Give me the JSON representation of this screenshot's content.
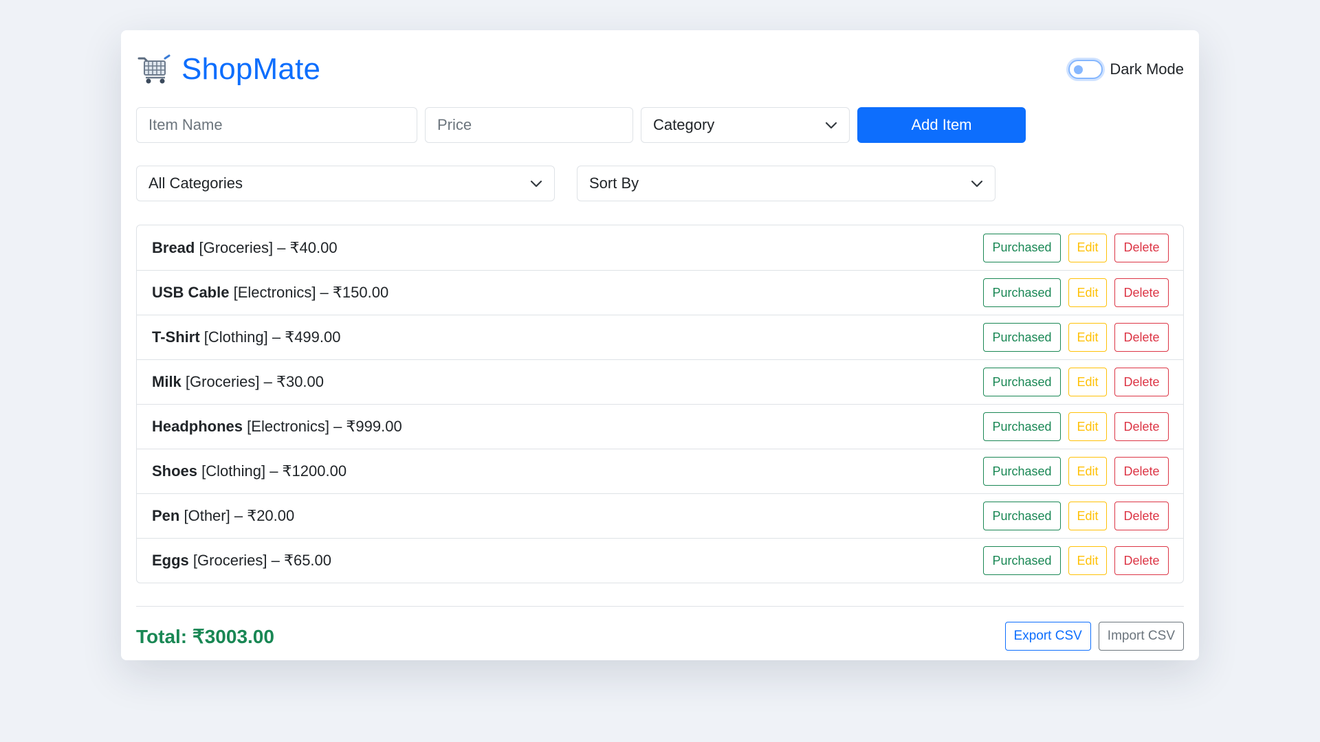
{
  "app": {
    "title": "ShopMate",
    "dark_mode_label": "Dark Mode",
    "dark_mode_on": false
  },
  "form": {
    "item_name_placeholder": "Item Name",
    "price_placeholder": "Price",
    "category_selected": "Category",
    "add_label": "Add Item"
  },
  "filters": {
    "category_selected": "All Categories",
    "sort_selected": "Sort By"
  },
  "items": [
    {
      "name": "Bread",
      "detail": "[Groceries] – ₹40.00"
    },
    {
      "name": "USB Cable",
      "detail": "[Electronics] – ₹150.00"
    },
    {
      "name": "T-Shirt",
      "detail": "[Clothing] – ₹499.00"
    },
    {
      "name": "Milk",
      "detail": "[Groceries] – ₹30.00"
    },
    {
      "name": "Headphones",
      "detail": "[Electronics] – ₹999.00"
    },
    {
      "name": "Shoes",
      "detail": "[Clothing] – ₹1200.00"
    },
    {
      "name": "Pen",
      "detail": "[Other] – ₹20.00"
    },
    {
      "name": "Eggs",
      "detail": "[Groceries] – ₹65.00"
    }
  ],
  "item_actions": {
    "purchased": "Purchased",
    "edit": "Edit",
    "delete": "Delete"
  },
  "footer": {
    "total": "Total: ₹3003.00",
    "export_label": "Export CSV",
    "import_label": "Import CSV"
  },
  "colors": {
    "primary": "#0d6efd",
    "success": "#198754",
    "warning": "#ffc107",
    "danger": "#dc3545",
    "secondary": "#6c757d"
  },
  "icons": {
    "brand": "shopping-cart-icon",
    "dropdown": "chevron-down-icon"
  }
}
